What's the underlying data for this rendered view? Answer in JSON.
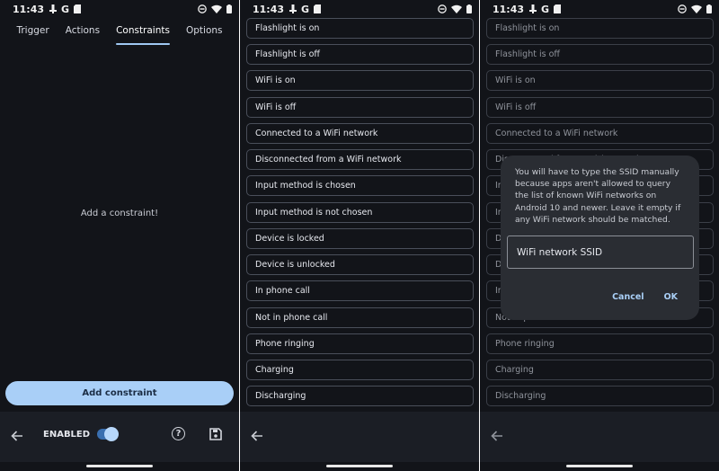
{
  "status": {
    "time": "11:43",
    "google": "G"
  },
  "panel1": {
    "tabs": [
      "Trigger",
      "Actions",
      "Constraints",
      "Options"
    ],
    "active_tab": "Constraints",
    "empty_message": "Add a constraint!",
    "primary_button": "Add constraint",
    "enabled_label": "ENABLED",
    "help_glyph": "?"
  },
  "constraints": [
    "Flashlight is on",
    "Flashlight is off",
    "WiFi is on",
    "WiFi is off",
    "Connected to a WiFi network",
    "Disconnected from a WiFi network",
    "Input method is chosen",
    "Input method is not chosen",
    "Device is locked",
    "Device is unlocked",
    "In phone call",
    "Not in phone call",
    "Phone ringing",
    "Charging",
    "Discharging"
  ],
  "dialog": {
    "message": "You will have to type the SSID manually because apps aren't allowed to query the list of known WiFi networks on Android 10 and newer. Leave it empty if any WiFi network should be matched.",
    "input_placeholder": "WiFi network SSID",
    "cancel": "Cancel",
    "ok": "OK"
  },
  "icons": {
    "back": "arrow-back-icon",
    "help": "help-circle-icon",
    "save": "save-icon",
    "dnd": "do-not-disturb-icon",
    "wifi": "wifi-icon",
    "battery": "battery-icon",
    "notification_a": "notification-icon",
    "notification_b": "sd-card-icon"
  },
  "colors": {
    "accent": "#a9cff7",
    "background": "#121419",
    "bar": "#1b1e25",
    "dialog": "#2a2d33"
  }
}
